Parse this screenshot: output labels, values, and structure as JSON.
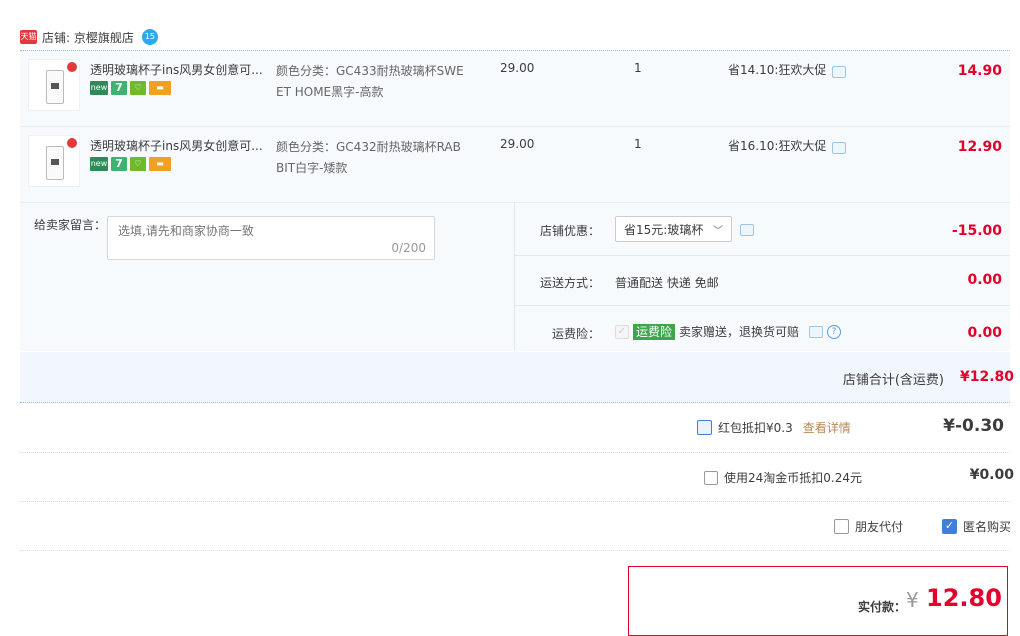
{
  "shop": {
    "badge": "天猫",
    "label": "店铺: 京樱旗舰店",
    "wangwang_badge": "15"
  },
  "items": [
    {
      "title": "透明玻璃杯子ins风男女创意可...",
      "spec": "颜色分类：GC433耐热玻璃杯SWEET HOME黑字-高款",
      "price": "29.00",
      "qty": "1",
      "promo": "省14.10:狂欢大促",
      "total": "14.90",
      "icons": [
        "new-icon",
        "seven-day-icon",
        "shopping-bag-icon",
        "card-icon"
      ]
    },
    {
      "title": "透明玻璃杯子ins风男女创意可...",
      "spec": "颜色分类：GC432耐热玻璃杯RABBIT白字-矮款",
      "price": "29.00",
      "qty": "1",
      "promo": "省16.10:狂欢大促",
      "total": "12.90",
      "icons": [
        "new-icon",
        "seven-day-icon",
        "shopping-bag-icon",
        "card-icon"
      ]
    }
  ],
  "remark": {
    "label": "给卖家留言：",
    "placeholder": "选填,请先和商家协商一致",
    "count": "0/200"
  },
  "shop_discount": {
    "label": "店铺优惠：",
    "selected": "省15元:玻璃杯",
    "value": "-15.00"
  },
  "shipping": {
    "label": "运送方式：",
    "method": "普通配送 快递 免邮",
    "value": "0.00"
  },
  "insurance": {
    "label": "运费险：",
    "tag": "运费险",
    "desc": "卖家赠送，退换货可赔",
    "value": "0.00"
  },
  "shop_total": {
    "label": "店铺合计(含运费)",
    "value": "¥12.80"
  },
  "red_packet": {
    "label": "红包抵扣¥0.3",
    "link": "查看详情",
    "value": "¥-0.30"
  },
  "coins": {
    "label": "使用24淘金币抵扣0.24元",
    "value": "¥0.00"
  },
  "friend_pay": {
    "label": "朋友代付"
  },
  "anonymous": {
    "label": "匿名购买"
  },
  "payment": {
    "label": "实付款：",
    "currency": "¥",
    "amount": "12.80"
  },
  "colors": {
    "accent": "#e4002b",
    "row_bg": "#f7fafd",
    "check": "#3e7fd8",
    "tag_green": "#3da64a"
  }
}
